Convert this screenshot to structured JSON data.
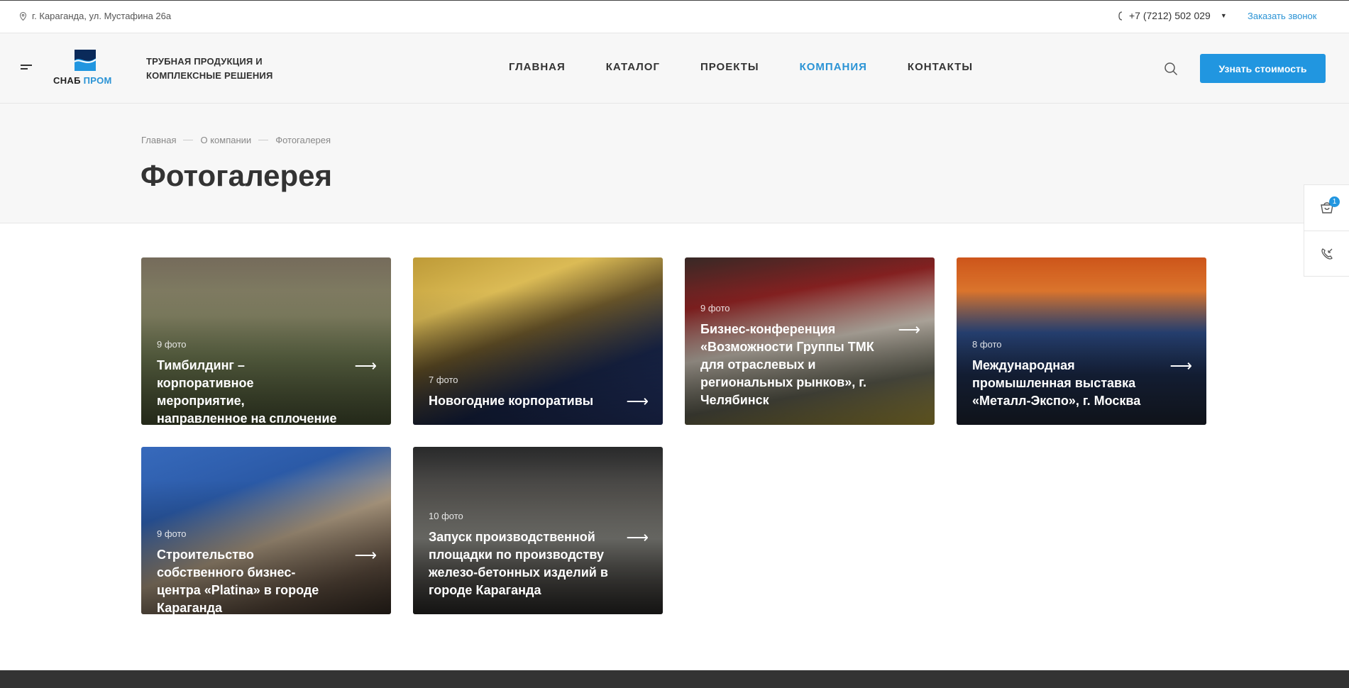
{
  "topbar": {
    "address": "г. Караганда, ул. Мустафина 26а",
    "phone": "+7 (7212) 502 029",
    "callback": "Заказать звонок"
  },
  "header": {
    "logo_left": "СНАБ",
    "logo_right": "ПРОМ",
    "tagline_line1": "ТРУБНАЯ ПРОДУКЦИЯ И",
    "tagline_line2": "КОМПЛЕКСНЫЕ РЕШЕНИЯ",
    "nav": [
      {
        "label": "ГЛАВНАЯ"
      },
      {
        "label": "КАТАЛОГ"
      },
      {
        "label": "ПРОЕКТЫ"
      },
      {
        "label": "КОМПАНИЯ",
        "active": true
      },
      {
        "label": "КОНТАКТЫ"
      }
    ],
    "cta": "Узнать стоимость"
  },
  "breadcrumb": [
    "Главная",
    "О компании",
    "Фотогалерея"
  ],
  "page_title": "Фотогалерея",
  "side_widgets": {
    "cart_count": "1"
  },
  "gallery": [
    {
      "count": "9 фото",
      "title": "Тимбилдинг – корпоративное мероприятие, направленное на сплочение коллектива"
    },
    {
      "count": "7 фото",
      "title": "Новогодние корпоративы"
    },
    {
      "count": "9 фото",
      "title": "Бизнес-конференция «Возможности Группы ТМК для отраслевых и региональных рынков», г. Челябинск"
    },
    {
      "count": "8 фото",
      "title": "Международная промышленная выставка «Металл-Экспо», г. Москва"
    },
    {
      "count": "9 фото",
      "title": "Строительство собственного бизнес-центра «Platina» в городе Караганда"
    },
    {
      "count": "10 фото",
      "title": "Запуск производственной площадки по производству железо-бетонных изделий в городе Караганда"
    }
  ],
  "colors": {
    "accent": "#2196e0",
    "link": "#2a93d5",
    "text": "#333333",
    "footer": "#333333"
  }
}
